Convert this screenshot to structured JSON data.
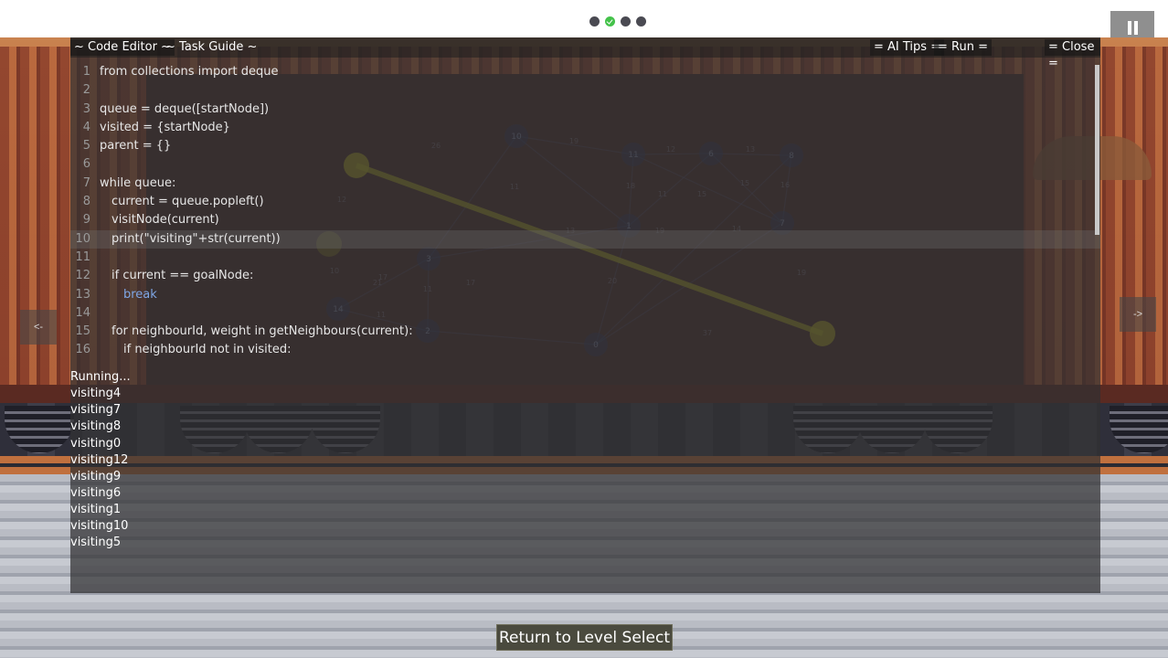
{
  "progress": {
    "dots": [
      "pending",
      "done",
      "pending",
      "pending"
    ]
  },
  "editor": {
    "tabs": {
      "code_editor": "~ Code Editor ~",
      "task_guide": "~ Task Guide ~"
    },
    "actions": {
      "ai_tips": "= AI Tips =",
      "run": "= Run =",
      "close": "= Close ="
    },
    "highlighted_line": 10,
    "code_lines": [
      "from collections import deque",
      "",
      "queue = deque([startNode])",
      "visited = {startNode}",
      "parent = {}",
      "",
      "while queue:",
      "current = queue.popleft()",
      "visitNode(current)",
      "print(\"visiting\"+str(current))",
      "",
      "if current == goalNode:",
      "break",
      "",
      "for neighbourId, weight in getNeighbours(current):",
      "if neighbourId not in visited:"
    ]
  },
  "graph": {
    "nodes": [
      "10",
      "11",
      "6",
      "8",
      "1",
      "7",
      "3",
      "14",
      "2",
      "0"
    ],
    "weights": [
      "26",
      "19",
      "12",
      "13",
      "15",
      "11",
      "18",
      "15",
      "16",
      "11",
      "12",
      "14",
      "17",
      "11",
      "21",
      "11",
      "10",
      "17",
      "19",
      "20",
      "19",
      "13",
      "37"
    ]
  },
  "console": {
    "lines": [
      "Running...",
      "visiting4",
      "visiting7",
      "visiting8",
      "visiting0",
      "visiting12",
      "visiting9",
      "visiting6",
      "visiting1",
      "visiting10",
      "visiting5"
    ]
  },
  "nav": {
    "prev": "<-",
    "next": "->"
  },
  "footer": {
    "return_label": "Return to Level Select"
  },
  "colors": {
    "accent_green": "#44c24a",
    "path_yellow": "#b5b020",
    "button_bg": "#4a4a3e"
  }
}
